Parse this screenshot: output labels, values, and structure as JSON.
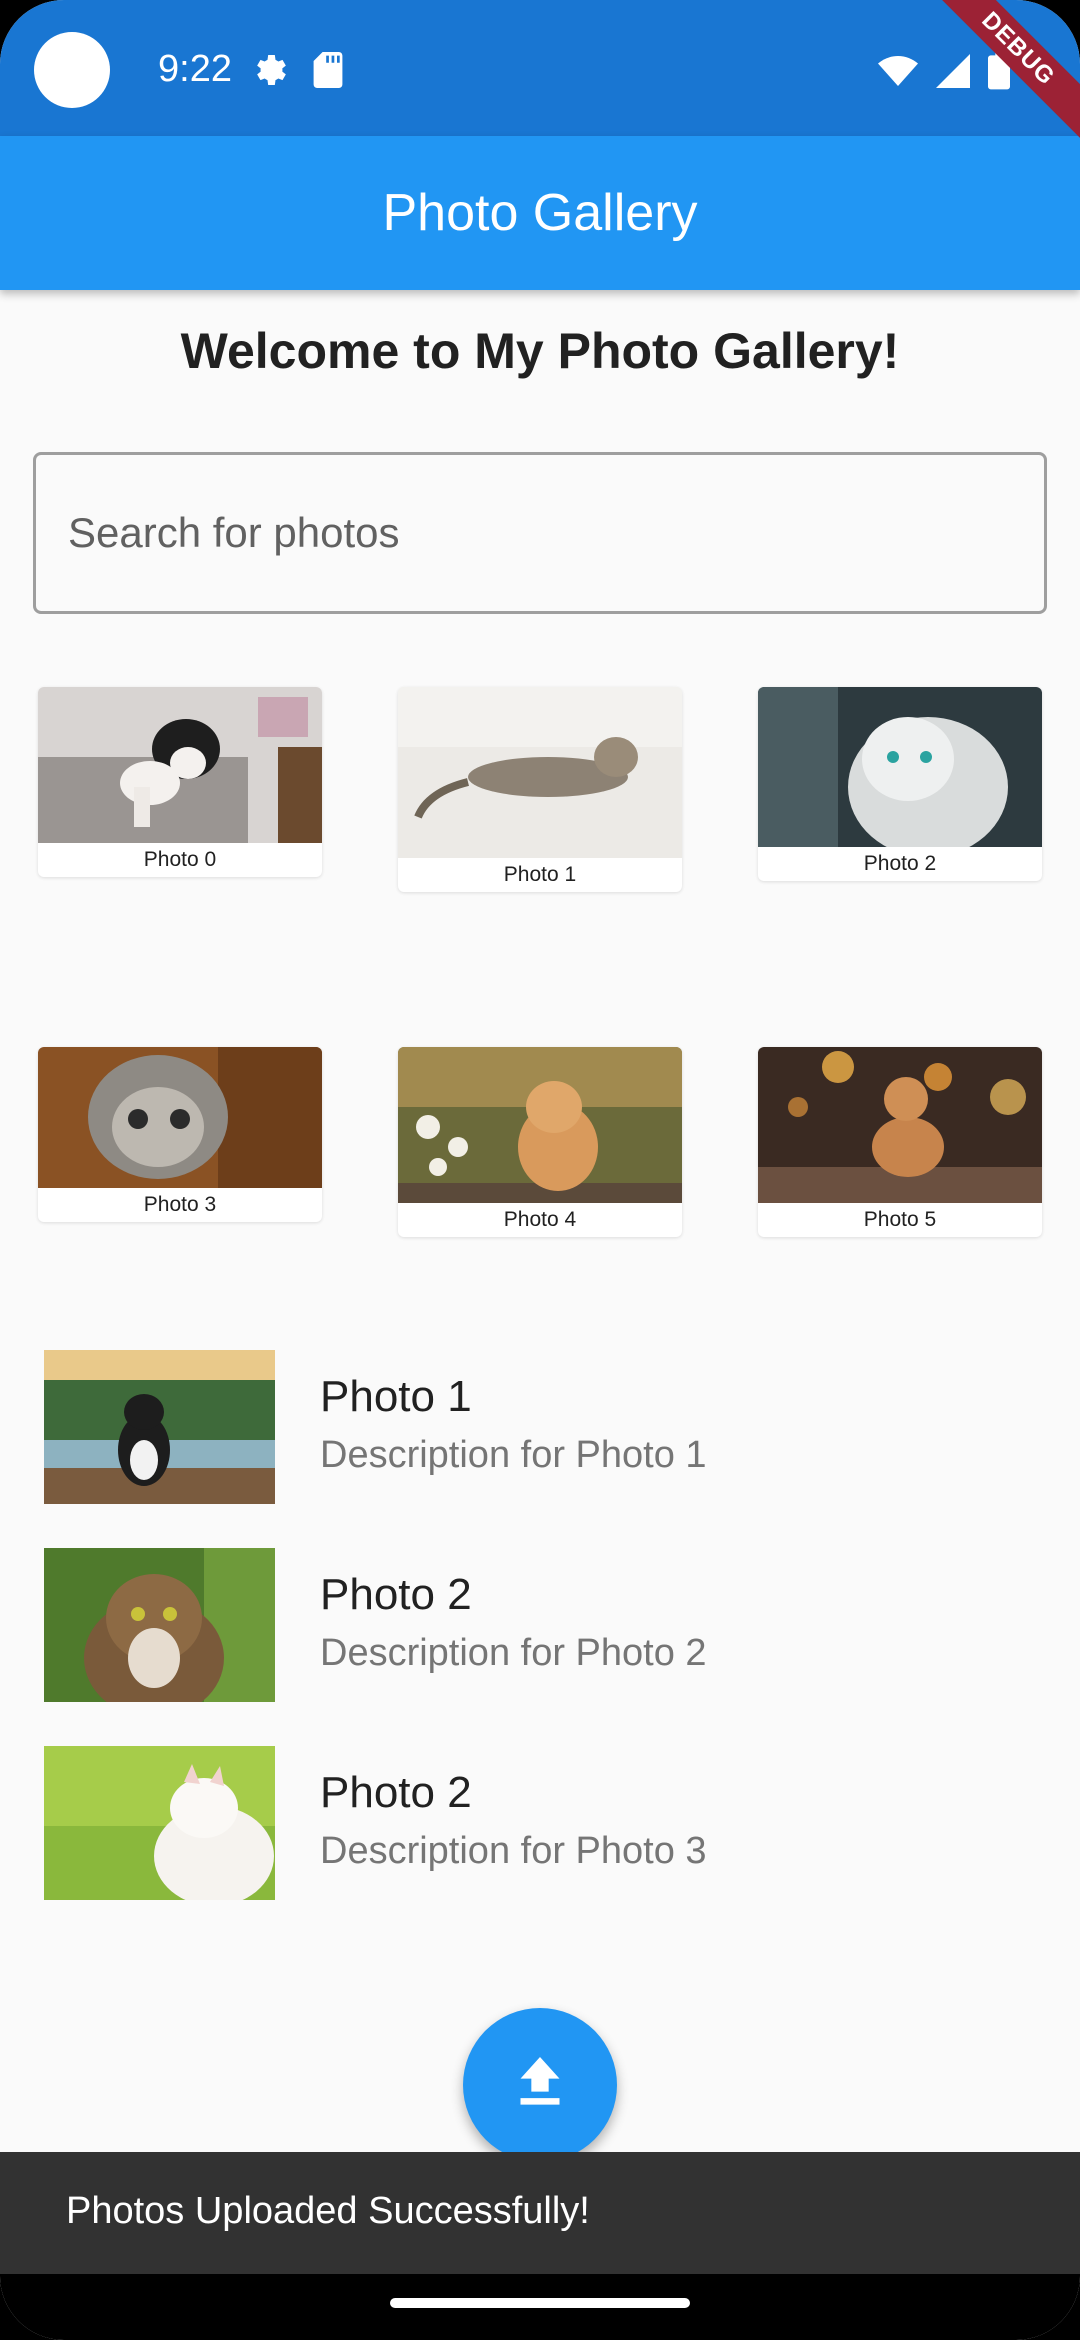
{
  "status_bar": {
    "time": "9:22"
  },
  "debug_label": "DEBUG",
  "app_bar": {
    "title": "Photo Gallery"
  },
  "welcome": "Welcome to My Photo Gallery!",
  "search": {
    "placeholder": "Search for photos",
    "value": ""
  },
  "grid": [
    {
      "caption": "Photo 0"
    },
    {
      "caption": "Photo 1"
    },
    {
      "caption": "Photo 2"
    },
    {
      "caption": "Photo 3"
    },
    {
      "caption": "Photo 4"
    },
    {
      "caption": "Photo 5"
    }
  ],
  "list": [
    {
      "title": "Photo 1",
      "description": "Description for Photo 1"
    },
    {
      "title": "Photo 2",
      "description": "Description for Photo 2"
    },
    {
      "title": "Photo 2",
      "description": "Description for Photo 3"
    }
  ],
  "fab": {
    "icon": "upload-icon"
  },
  "snackbar": {
    "message": "Photos Uploaded Successfully!"
  },
  "colors": {
    "status_bar": "#1976d2",
    "app_bar": "#2196f3",
    "fab": "#2196f3",
    "snackbar": "#323232",
    "background": "#fafafa"
  }
}
